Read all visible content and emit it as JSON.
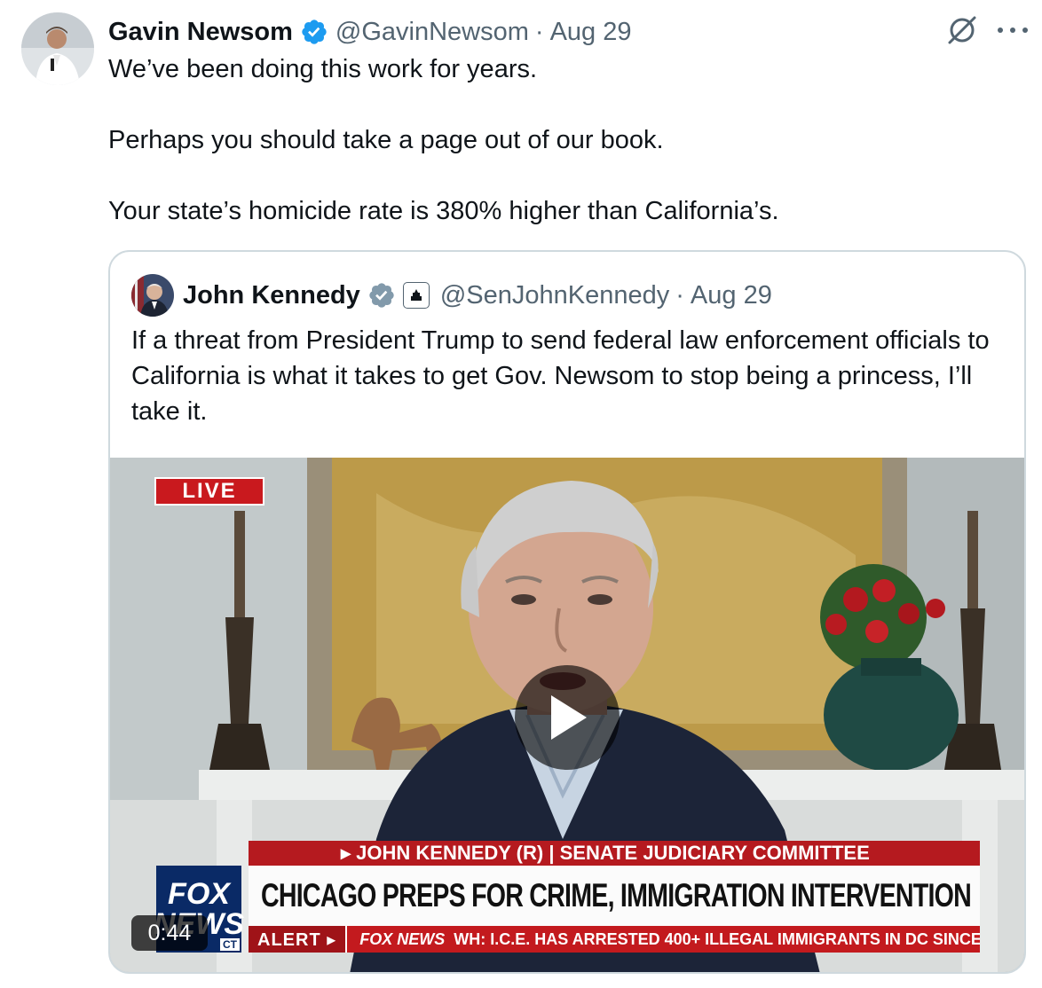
{
  "tweet": {
    "author_name": "Gavin Newsom",
    "author_handle": "@GavinNewsom",
    "separator": "·",
    "date": "Aug 29",
    "lines": [
      "We’ve been doing this work for years.",
      "Perhaps you should take a page out of our book.",
      "Your state’s homicide rate is 380% higher than California’s."
    ]
  },
  "quoted": {
    "author_name": "John Kennedy",
    "author_handle": "@SenJohnKennedy",
    "separator": "·",
    "date": "Aug 29",
    "text": "If a threat from President Trump to send federal law enforcement officials to California is what it takes to get Gov. Newsom to stop being a princess, I’ll take it.",
    "video": {
      "live_label": "LIVE",
      "duration": "0:44",
      "chyron_top": "▸ JOHN KENNEDY (R) | SENATE JUDICIARY COMMITTEE",
      "chyron_main": "CHICAGO PREPS FOR CRIME, IMMIGRATION INTERVENTION",
      "alert_label": "ALERT ▸",
      "ticker_brand": "FOX NEWS",
      "ticker_text": "WH: I.C.E. HAS ARRESTED 400+ ILLEGAL IMMIGRANTS IN DC SINCE",
      "logo_line1": "FOX",
      "logo_line2": "NEWS",
      "logo_tz": "CT"
    }
  },
  "colors": {
    "verified_blue": "#1d9bf0",
    "secondary_text": "#536471",
    "border": "#cfd9de",
    "fox_red": "#c31a1e",
    "fox_blue": "#0a2a66"
  },
  "icons": {
    "verified": "verified-badge-icon",
    "grok": "grok-icon",
    "more": "more-options-icon",
    "government": "government-label-icon",
    "play": "play-icon"
  }
}
